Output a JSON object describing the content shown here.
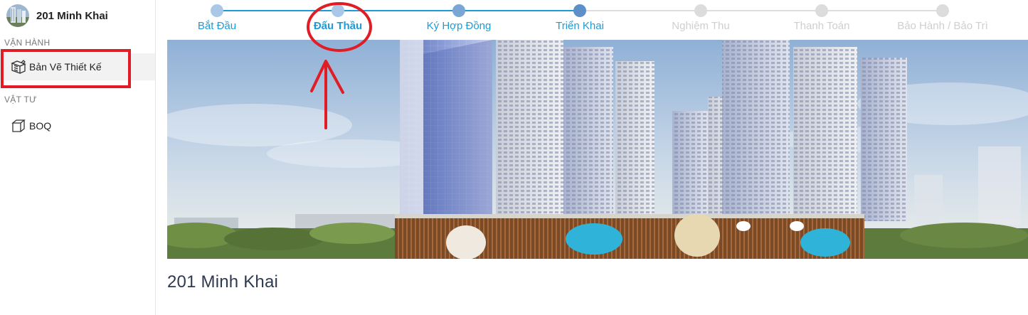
{
  "project": {
    "name": "201 Minh Khai",
    "avatar_icon": "building-avatar-icon"
  },
  "sidebar": {
    "sections": [
      {
        "title": "VẬN HÀNH",
        "items": [
          {
            "label": "Bản Vẽ Thiết Kế",
            "icon": "blueprint-icon",
            "active": true
          }
        ]
      },
      {
        "title": "VẬT TƯ",
        "items": [
          {
            "label": "BOQ",
            "icon": "box-icon",
            "active": false
          }
        ]
      }
    ]
  },
  "stepper": {
    "steps": [
      {
        "label": "Bắt Đầu",
        "state": "done"
      },
      {
        "label": "Đấu Thầu",
        "state": "current"
      },
      {
        "label": "Ký Hợp Đồng",
        "state": "done"
      },
      {
        "label": "Triển Khai",
        "state": "active"
      },
      {
        "label": "Nghiệm Thu",
        "state": "pending"
      },
      {
        "label": "Thanh Toán",
        "state": "pending"
      },
      {
        "label": "Bảo Hành / Bảo Trì",
        "state": "pending"
      }
    ]
  },
  "main": {
    "title": "201 Minh Khai",
    "banner_image": "building-rendering"
  },
  "colors": {
    "accent": "#1e9bd7",
    "step_done": "#a9c8e8",
    "step_active": "#5d8fc9",
    "step_pending": "#d9d9d9",
    "annotation": "#e01c24",
    "title": "#2d3a4f"
  }
}
